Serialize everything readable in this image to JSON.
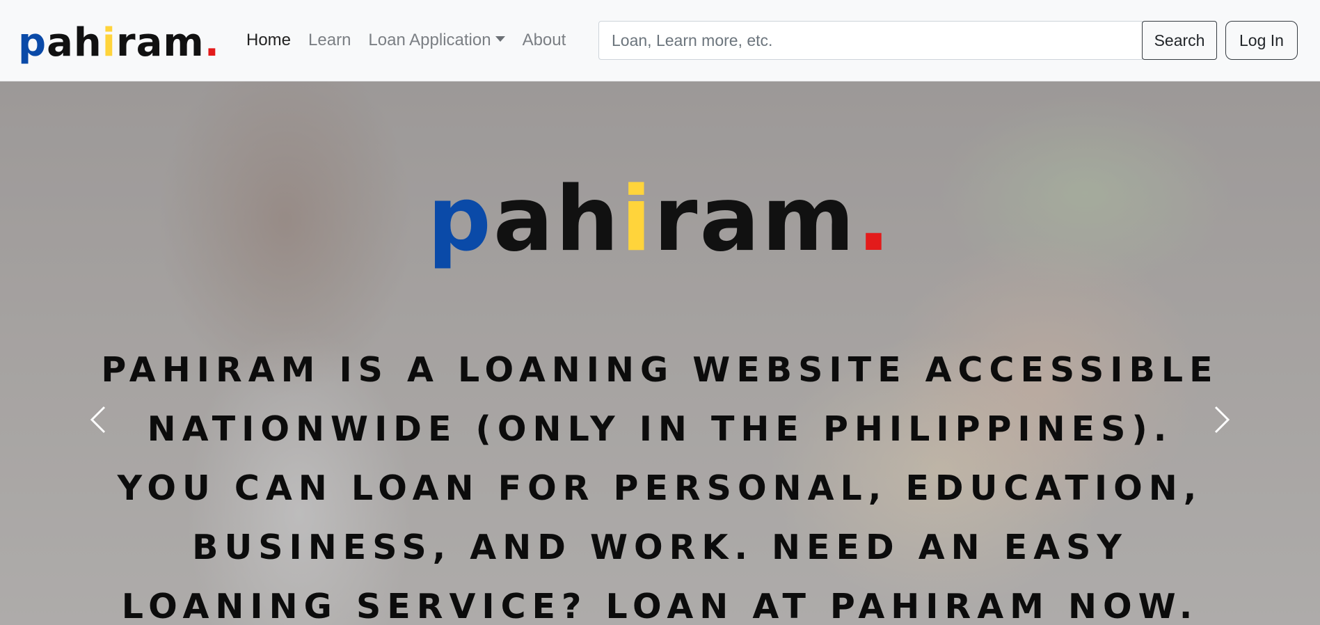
{
  "brand": {
    "letters": [
      {
        "ch": "p",
        "color": "blue"
      },
      {
        "ch": "a",
        "color": "black"
      },
      {
        "ch": "h",
        "color": "black"
      },
      {
        "ch": "i",
        "color": "yellow"
      },
      {
        "ch": "r",
        "color": "black"
      },
      {
        "ch": "a",
        "color": "black"
      },
      {
        "ch": "m",
        "color": "black"
      },
      {
        "ch": ".",
        "color": "red"
      }
    ],
    "colors": {
      "blue": "#0a4aa8",
      "black": "#111111",
      "yellow": "#ffd43b",
      "red": "#e31b1b"
    }
  },
  "nav": {
    "home": "Home",
    "learn": "Learn",
    "loan_application": "Loan Application",
    "about": "About"
  },
  "search": {
    "placeholder": "Loan, Learn more, etc.",
    "button": "Search"
  },
  "login_button": "Log In",
  "hero": {
    "description": "PAHIRAM IS A LOANING WEBSITE ACCESSIBLE NATIONWIDE (ONLY IN THE PHILIPPINES). YOU CAN LOAN FOR PERSONAL, EDUCATION, BUSINESS, AND WORK. NEED AN EASY LOANING SERVICE? LOAN AT PAHIRAM NOW.",
    "prev_icon": "chevron-left-icon",
    "next_icon": "chevron-right-icon"
  }
}
